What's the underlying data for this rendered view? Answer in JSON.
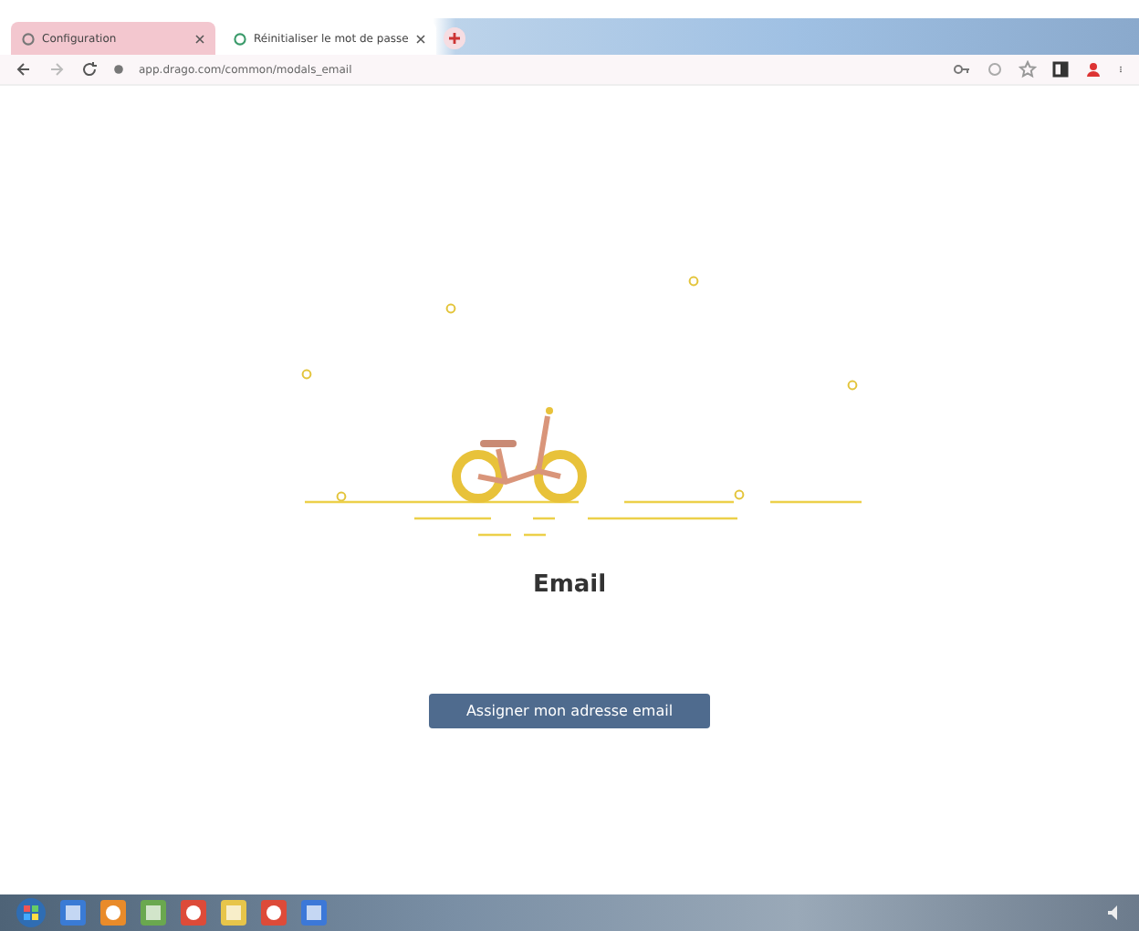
{
  "browser": {
    "tabs": [
      {
        "title": "Configuration",
        "selected": false
      },
      {
        "title": "Réinitialiser le mot de passe",
        "selected": true
      }
    ],
    "address": "app.drago.com/common/modals_email"
  },
  "page": {
    "title": "Email",
    "button": "Assigner mon adresse email"
  }
}
